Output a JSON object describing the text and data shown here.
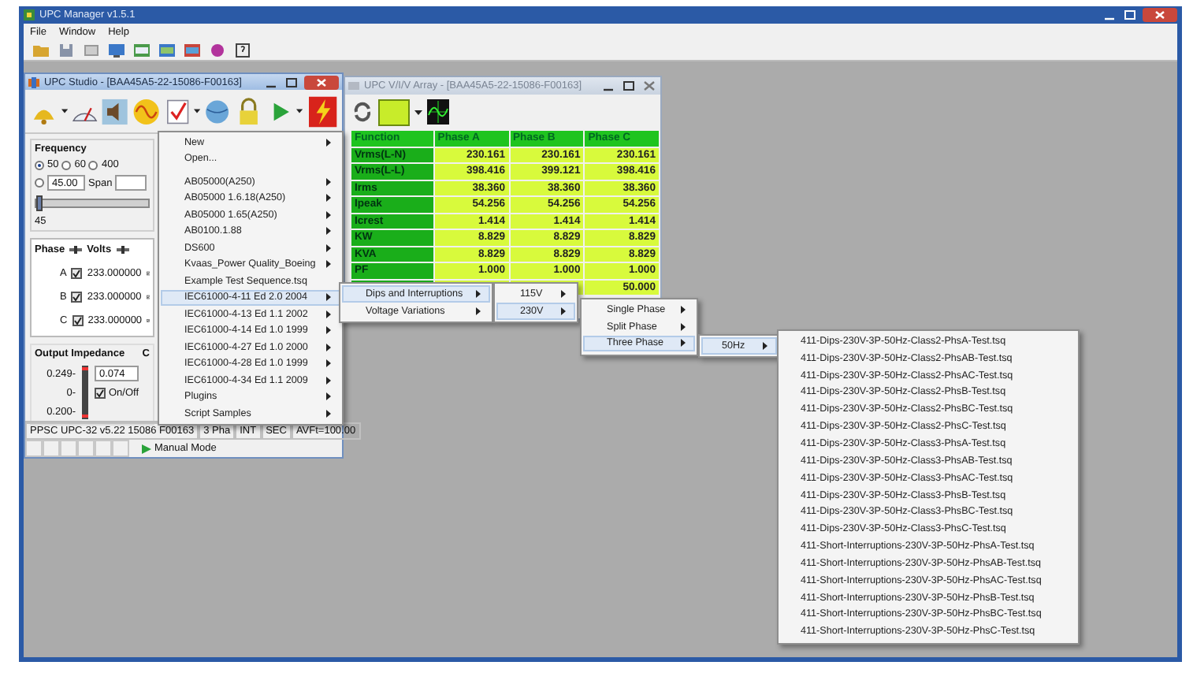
{
  "app": {
    "title": "UPC Manager v1.5.1",
    "menu": [
      "File",
      "Window",
      "Help"
    ]
  },
  "studio": {
    "title": "UPC Studio - [BAA45A5-22-15086-F00163]",
    "frequency": {
      "label": "Frequency",
      "options": [
        {
          "label": "50",
          "selected": true
        },
        {
          "label": "60",
          "selected": false
        },
        {
          "label": "400",
          "selected": false
        }
      ],
      "custom_selected": false,
      "custom_value": "45.00",
      "span_label": "Span",
      "level": 0.0,
      "slider_label": "45"
    },
    "phases": {
      "headers": [
        "Phase",
        "Volts"
      ],
      "rows": [
        {
          "phase": "A",
          "enabled": true,
          "volts": "233.000000"
        },
        {
          "phase": "B",
          "enabled": true,
          "volts": "233.000000"
        },
        {
          "phase": "C",
          "enabled": true,
          "volts": "233.000000"
        }
      ]
    },
    "impedance": {
      "label": "Output Impedance",
      "side_label": "C",
      "scale": [
        "0.249-",
        "0-",
        "0.200-"
      ],
      "value": "0.074",
      "on_off_label": "On/Off",
      "on": true
    },
    "status": [
      "PPSC UPC-32 v5.22 15086 F00163",
      "3 Pha",
      "INT",
      "SEC",
      "AVFt=100.00"
    ],
    "mode": "Manual Mode"
  },
  "data_window": {
    "title": "UPC V/I/V Array - [BAA45A5-22-15086-F00163]",
    "columns": [
      "Function",
      "Phase A",
      "Phase B",
      "Phase C"
    ],
    "rows": [
      {
        "label": "Vrms(L-N)",
        "values": [
          "230.161",
          "230.161",
          "230.161"
        ]
      },
      {
        "label": "Vrms(L-L)",
        "values": [
          "398.416",
          "399.121",
          "398.416"
        ]
      },
      {
        "label": "Irms",
        "values": [
          "38.360",
          "38.360",
          "38.360"
        ]
      },
      {
        "label": "Ipeak",
        "values": [
          "54.256",
          "54.256",
          "54.256"
        ]
      },
      {
        "label": "Icrest",
        "values": [
          "1.414",
          "1.414",
          "1.414"
        ]
      },
      {
        "label": "KW",
        "values": [
          "8.829",
          "8.829",
          "8.829"
        ]
      },
      {
        "label": "KVA",
        "values": [
          "8.829",
          "8.829",
          "8.829"
        ]
      },
      {
        "label": "PF",
        "values": [
          "1.000",
          "1.000",
          "1.000"
        ]
      },
      {
        "phase_c": "50.000"
      }
    ]
  },
  "menus": [
    {
      "groups": [
        [
          {
            "label": "New",
            "submenu": true,
            "selected": false
          },
          {
            "label": "Open...",
            "submenu": false,
            "selected": false
          }
        ],
        [
          {
            "label": "AB05000(A250)",
            "submenu": true,
            "selected": false
          },
          {
            "label": "AB05000 1.6.18(A250)",
            "submenu": true,
            "selected": false
          },
          {
            "label": "AB05000 1.65(A250)",
            "submenu": true,
            "selected": false
          },
          {
            "label": "AB0100.1.88",
            "submenu": true,
            "selected": false
          },
          {
            "label": "DS600",
            "submenu": true,
            "selected": false
          },
          {
            "label": "Kvaas_Power Quality_Boeing",
            "submenu": true,
            "selected": false
          },
          {
            "label": "Example Test Sequence.tsq",
            "submenu": false,
            "selected": false
          },
          {
            "label": "IEC61000-4-11 Ed 2.0 2004",
            "submenu": true,
            "selected": true
          },
          {
            "label": "IEC61000-4-13 Ed 1.1 2002",
            "submenu": true,
            "selected": false
          },
          {
            "label": "IEC61000-4-14 Ed 1.0 1999",
            "submenu": true,
            "selected": false
          },
          {
            "label": "IEC61000-4-27 Ed 1.0 2000",
            "submenu": true,
            "selected": false
          },
          {
            "label": "IEC61000-4-28 Ed 1.0 1999",
            "submenu": true,
            "selected": false
          },
          {
            "label": "IEC61000-4-34 Ed 1.1 2009",
            "submenu": true,
            "selected": false
          },
          {
            "label": "Plugins",
            "submenu": true,
            "selected": false
          },
          {
            "label": "Script Samples",
            "submenu": true,
            "selected": false
          }
        ]
      ]
    },
    {
      "groups": [
        [
          {
            "label": "Dips and Interruptions",
            "submenu": true,
            "selected": true
          },
          {
            "label": "Voltage Variations",
            "submenu": true,
            "selected": false
          }
        ]
      ]
    },
    {
      "groups": [
        [
          {
            "label": "115V",
            "submenu": true,
            "selected": false
          },
          {
            "label": "230V",
            "submenu": true,
            "selected": true
          }
        ]
      ]
    },
    {
      "groups": [
        [
          {
            "label": "Single Phase",
            "submenu": true,
            "selected": false
          },
          {
            "label": "Split Phase",
            "submenu": true,
            "selected": false
          },
          {
            "label": "Three Phase",
            "submenu": true,
            "selected": true
          }
        ]
      ]
    },
    {
      "groups": [
        [
          {
            "label": "50Hz",
            "submenu": true,
            "selected": true
          }
        ]
      ]
    },
    {
      "groups": [
        [
          {
            "label": "411-Dips-230V-3P-50Hz-Class2-PhsA-Test.tsq",
            "submenu": false,
            "selected": false
          },
          {
            "label": "411-Dips-230V-3P-50Hz-Class2-PhsAB-Test.tsq",
            "submenu": false,
            "selected": false
          },
          {
            "label": "411-Dips-230V-3P-50Hz-Class2-PhsAC-Test.tsq",
            "submenu": false,
            "selected": false
          },
          {
            "label": "411-Dips-230V-3P-50Hz-Class2-PhsB-Test.tsq",
            "submenu": false,
            "selected": false
          },
          {
            "label": "411-Dips-230V-3P-50Hz-Class2-PhsBC-Test.tsq",
            "submenu": false,
            "selected": false
          },
          {
            "label": "411-Dips-230V-3P-50Hz-Class2-PhsC-Test.tsq",
            "submenu": false,
            "selected": false
          },
          {
            "label": "411-Dips-230V-3P-50Hz-Class3-PhsA-Test.tsq",
            "submenu": false,
            "selected": false
          },
          {
            "label": "411-Dips-230V-3P-50Hz-Class3-PhsAB-Test.tsq",
            "submenu": false,
            "selected": false
          },
          {
            "label": "411-Dips-230V-3P-50Hz-Class3-PhsAC-Test.tsq",
            "submenu": false,
            "selected": false
          },
          {
            "label": "411-Dips-230V-3P-50Hz-Class3-PhsB-Test.tsq",
            "submenu": false,
            "selected": false
          },
          {
            "label": "411-Dips-230V-3P-50Hz-Class3-PhsBC-Test.tsq",
            "submenu": false,
            "selected": false
          },
          {
            "label": "411-Dips-230V-3P-50Hz-Class3-PhsC-Test.tsq",
            "submenu": false,
            "selected": false
          },
          {
            "label": "411-Short-Interruptions-230V-3P-50Hz-PhsA-Test.tsq",
            "submenu": false,
            "selected": false
          },
          {
            "label": "411-Short-Interruptions-230V-3P-50Hz-PhsAB-Test.tsq",
            "submenu": false,
            "selected": false
          },
          {
            "label": "411-Short-Interruptions-230V-3P-50Hz-PhsAC-Test.tsq",
            "submenu": false,
            "selected": false
          },
          {
            "label": "411-Short-Interruptions-230V-3P-50Hz-PhsB-Test.tsq",
            "submenu": false,
            "selected": false
          },
          {
            "label": "411-Short-Interruptions-230V-3P-50Hz-PhsBC-Test.tsq",
            "submenu": false,
            "selected": false
          },
          {
            "label": "411-Short-Interruptions-230V-3P-50Hz-PhsC-Test.tsq",
            "submenu": false,
            "selected": false
          }
        ]
      ]
    }
  ]
}
